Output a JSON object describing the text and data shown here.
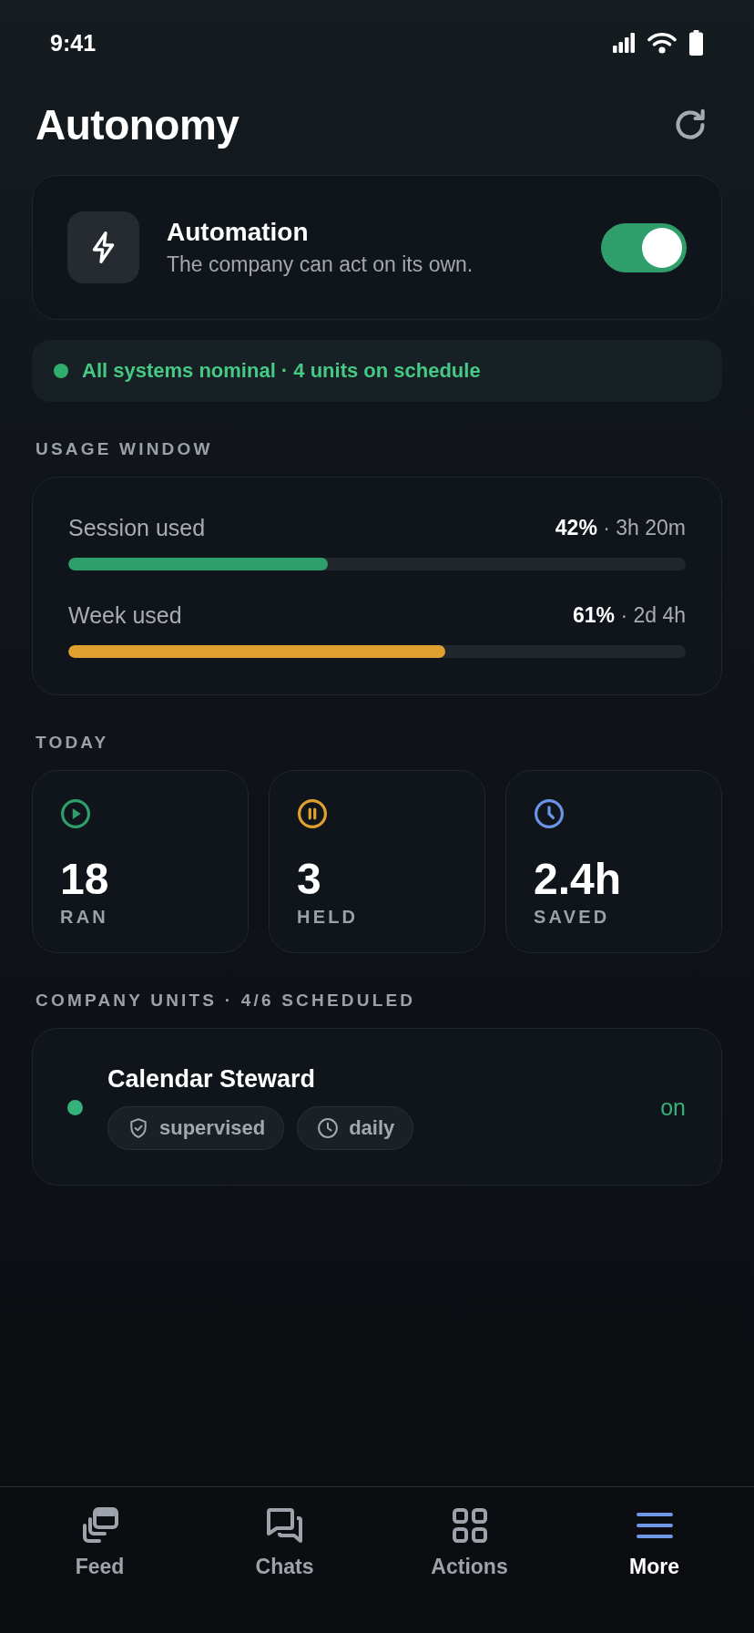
{
  "status_bar": {
    "time": "9:41"
  },
  "header": {
    "title": "Autonomy"
  },
  "automation": {
    "title": "Automation",
    "subtitle": "The company can act on its own.",
    "on": true
  },
  "status_banner": {
    "text": "All systems nominal · 4 units on schedule"
  },
  "usage": {
    "heading": "USAGE WINDOW",
    "meters": [
      {
        "label": "Session used",
        "reading": "**42%** · 3h 20m",
        "level": 0.42,
        "color": "#2e9e6a"
      },
      {
        "label": "Week used",
        "reading": "**61%** · 2d 4h",
        "level": 0.61,
        "color": "#e0a030"
      }
    ]
  },
  "today": {
    "heading": "TODAY",
    "stats": [
      {
        "kind": "play",
        "value": "18",
        "label": "RAN",
        "color": "#2e9e6a"
      },
      {
        "kind": "pause",
        "value": "3",
        "label": "HELD",
        "color": "#e0a030"
      },
      {
        "kind": "clock",
        "value": "2.4h",
        "label": "SAVED",
        "color": "#6b94e6"
      }
    ]
  },
  "units": {
    "heading": "COMPANY UNITS · 4/6 SCHEDULED",
    "items": [
      {
        "name": "Calendar Steward",
        "color": "#34b27a",
        "tags": [
          {
            "kind": "shield",
            "label": "supervised"
          },
          {
            "kind": "clock",
            "label": "daily"
          }
        ],
        "status": "on"
      }
    ]
  },
  "nav": {
    "items": [
      {
        "kind": "feed",
        "label": "Feed",
        "selected": false
      },
      {
        "kind": "chats",
        "label": "Chats",
        "selected": false
      },
      {
        "kind": "actions",
        "label": "Actions",
        "selected": false
      },
      {
        "kind": "more",
        "label": "More",
        "selected": true
      }
    ]
  }
}
